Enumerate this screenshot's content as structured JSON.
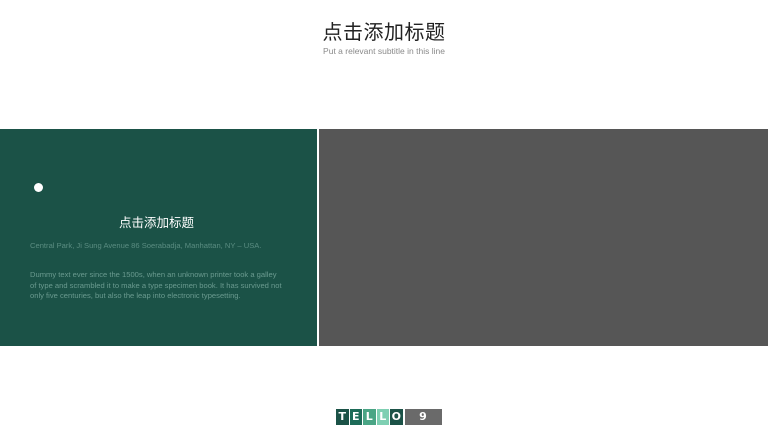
{
  "header": {
    "title": "点击添加标题",
    "subtitle": "Put a relevant subtitle in this line"
  },
  "card": {
    "title": "点击添加标题",
    "address": "Central Park, Ji Sung Avenue 86 Soerabadja, Manhattan, NY – USA.",
    "body": "Dummy text ever since the 1500s,  when an unknown printer took a galley of type and scrambled it to make a type specimen book. It has survived not only five centuries, but also the leap into electronic typesetting."
  },
  "logo": {
    "letters": [
      {
        "char": "T",
        "color": "#1b5247"
      },
      {
        "char": "E",
        "color": "#1d6b58"
      },
      {
        "char": "L",
        "color": "#4aa585"
      },
      {
        "char": "L",
        "color": "#7ecfb2"
      },
      {
        "char": "O",
        "color": "#1b5247"
      }
    ],
    "number": "9"
  },
  "colors": {
    "panel_green": "#1b5247",
    "panel_gray": "#565656"
  }
}
